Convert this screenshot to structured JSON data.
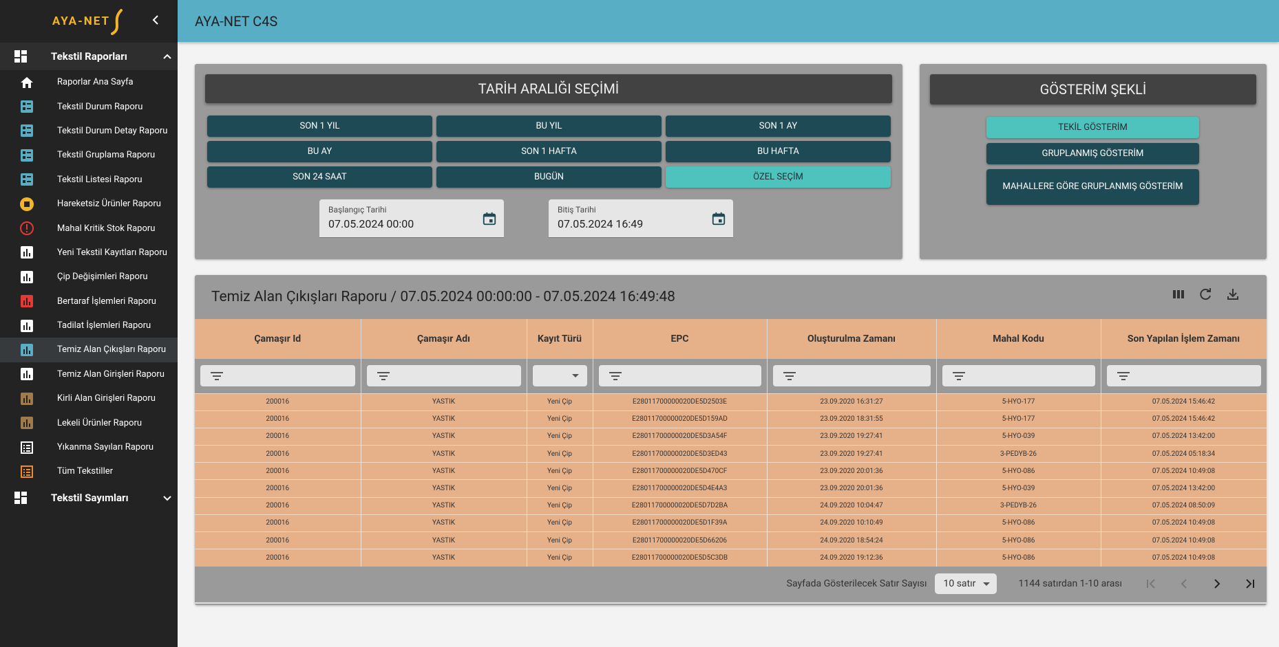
{
  "app": {
    "logo_text": "AYA-NET",
    "title": "AYA-NET C4S"
  },
  "sidebar": {
    "group1": {
      "label": "Tekstil Raporları"
    },
    "items": [
      {
        "label": "Raporlar Ana Sayfa",
        "icon": "home-icon",
        "color": "#ffffff"
      },
      {
        "label": "Tekstil Durum Raporu",
        "icon": "checklist-icon",
        "color": "#57aec5"
      },
      {
        "label": "Tekstil Durum Detay Raporu",
        "icon": "checklist-icon",
        "color": "#57aec5"
      },
      {
        "label": "Tekstil Gruplama Raporu",
        "icon": "checklist-icon",
        "color": "#57aec5"
      },
      {
        "label": "Tekstil Listesi Raporu",
        "icon": "checklist-icon",
        "color": "#57aec5"
      },
      {
        "label": "Hareketsiz Ürünler Raporu",
        "icon": "stop-circle-icon",
        "color": "#f1b52b"
      },
      {
        "label": "Mahal Kritik Stok Raporu",
        "icon": "alert-circle-icon",
        "color": "#e53935"
      },
      {
        "label": "Yeni Tekstil Kayıtları Raporu",
        "icon": "bar-chart-icon",
        "color": "#ffffff"
      },
      {
        "label": "Çip Değişimleri Raporu",
        "icon": "bar-chart-icon",
        "color": "#ffffff"
      },
      {
        "label": "Bertaraf İşlemleri Raporu",
        "icon": "bar-chart-icon",
        "color": "#e53935"
      },
      {
        "label": "Tadilat İşlemleri Raporu",
        "icon": "bar-chart-icon",
        "color": "#ffffff"
      },
      {
        "label": "Temiz Alan Çıkışları Raporu",
        "icon": "bar-chart-icon",
        "color": "#57aec5",
        "active": true
      },
      {
        "label": "Temiz Alan Girişleri Raporu",
        "icon": "bar-chart-icon",
        "color": "#ffffff"
      },
      {
        "label": "Kirli Alan Girişleri Raporu",
        "icon": "bar-chart-icon",
        "color": "#a07a4a"
      },
      {
        "label": "Lekeli Ürünler Raporu",
        "icon": "bar-chart-icon",
        "color": "#a07a4a"
      },
      {
        "label": "Yıkanma Sayıları Raporu",
        "icon": "list-icon",
        "color": "#ffffff"
      },
      {
        "label": "Tüm Tekstiller",
        "icon": "list-icon",
        "color": "#f08a2c"
      }
    ],
    "group2": {
      "label": "Tekstil Sayımları"
    }
  },
  "date_panel": {
    "title": "TARİH ARALIĞI SEÇİMİ",
    "buttons": [
      {
        "label": "SON 1 YIL"
      },
      {
        "label": "BU YIL"
      },
      {
        "label": "SON 1 AY"
      },
      {
        "label": "BU AY"
      },
      {
        "label": "SON 1 HAFTA"
      },
      {
        "label": "BU HAFTA"
      },
      {
        "label": "SON 24 SAAT"
      },
      {
        "label": "BUGÜN"
      },
      {
        "label": "ÖZEL SEÇİM",
        "selected": true
      }
    ],
    "start": {
      "label": "Başlangıç Tarihi",
      "value": "07.05.2024 00:00"
    },
    "end": {
      "label": "Bitiş Tarihi",
      "value": "07.05.2024 16:49"
    }
  },
  "view_panel": {
    "title": "GÖSTERİM ŞEKLİ",
    "buttons": [
      {
        "label": "TEKİL GÖSTERİM",
        "selected": true
      },
      {
        "label": "GRUPLANMIŞ GÖSTERİM"
      },
      {
        "label": "MAHALLERE GÖRE GRUPLANMIŞ GÖSTERİM"
      }
    ]
  },
  "report": {
    "title": "Temiz Alan Çıkışları Raporu / 07.05.2024 00:00:00 - 07.05.2024 16:49:48",
    "columns": [
      "Çamaşır Id",
      "Çamaşır Adı",
      "Kayıt Türü",
      "EPC",
      "Oluşturulma Zamanı",
      "Mahal Kodu",
      "Son Yapılan İşlem Zamanı"
    ],
    "rows": [
      [
        "200016",
        "YASTIK",
        "Yeni Çip",
        "E28011700000020DE5D2503E",
        "23.09.2020 16:31:27",
        "5-HYO-177",
        "07.05.2024 15:46:42"
      ],
      [
        "200016",
        "YASTIK",
        "Yeni Çip",
        "E28011700000020DE5D159AD",
        "23.09.2020 18:31:55",
        "5-HYO-177",
        "07.05.2024 15:46:42"
      ],
      [
        "200016",
        "YASTIK",
        "Yeni Çip",
        "E28011700000020DE5D3A54F",
        "23.09.2020 19:27:41",
        "5-HYO-039",
        "07.05.2024 13:42:00"
      ],
      [
        "200016",
        "YASTIK",
        "Yeni Çip",
        "E28011700000020DE5D3ED43",
        "23.09.2020 19:27:41",
        "3-PEDYB-26",
        "07.05.2024 05:18:34"
      ],
      [
        "200016",
        "YASTIK",
        "Yeni Çip",
        "E28011700000020DE5D470CF",
        "23.09.2020 20:01:36",
        "5-HYO-086",
        "07.05.2024 10:49:08"
      ],
      [
        "200016",
        "YASTIK",
        "Yeni Çip",
        "E28011700000020DE5D4E4A3",
        "23.09.2020 20:01:36",
        "5-HYO-039",
        "07.05.2024 13:42:00"
      ],
      [
        "200016",
        "YASTIK",
        "Yeni Çip",
        "E28011700000020DE5D7D2BA",
        "24.09.2020 10:04:47",
        "3-PEDYB-26",
        "07.05.2024 08:50:09"
      ],
      [
        "200016",
        "YASTIK",
        "Yeni Çip",
        "E28011700000020DE5D1F39A",
        "24.09.2020 10:10:49",
        "5-HYO-086",
        "07.05.2024 10:49:08"
      ],
      [
        "200016",
        "YASTIK",
        "Yeni Çip",
        "E28011700000020DE5D66206",
        "24.09.2020 18:54:24",
        "5-HYO-086",
        "07.05.2024 10:49:08"
      ],
      [
        "200016",
        "YASTIK",
        "Yeni Çip",
        "E28011700000020DE5D5C3DB",
        "24.09.2020 19:12:36",
        "5-HYO-086",
        "07.05.2024 10:49:08"
      ]
    ],
    "footer": {
      "rows_per_page_label": "Sayfada Gösterilecek Satır Sayısı",
      "rows_per_page_value": "10 satır",
      "range_text": "1144 satırdan 1-10 arası"
    }
  },
  "colors": {
    "topbar": "#57aec5",
    "sidebar_bg": "#232323",
    "button_dark": "#1e4a55",
    "button_selected": "#4ec3bd",
    "table_row": "#e6b089",
    "logo": "#f1b52b"
  }
}
